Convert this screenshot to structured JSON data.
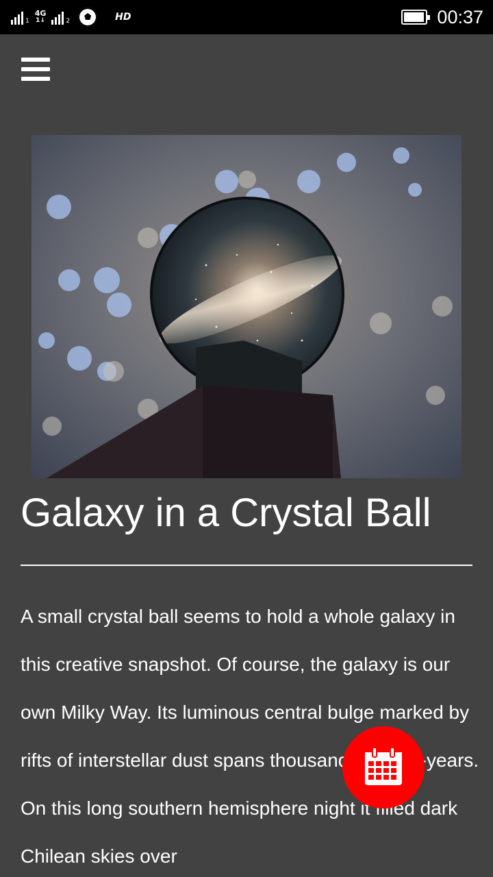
{
  "status_bar": {
    "sim1_label": "1",
    "sim2_label": "2",
    "network_type": "4G",
    "network_arrows": "1↓",
    "hd_label": "HD",
    "time": "00:37",
    "battery_level": 0.95
  },
  "app": {
    "menu_icon": "hamburger-menu-icon",
    "fab_icon": "calendar-icon",
    "fab_color": "#ff0000",
    "background_color": "#424242"
  },
  "article": {
    "image_alt": "crystal ball holding the Milky Way",
    "title": "Galaxy in a Crystal Ball",
    "body": "A small crystal ball seems to hold a whole galaxy in this creative snapshot. Of course, the galaxy is our own Milky Way. Its luminous central bulge marked by rifts of interstellar dust spans thousands of light-years. On this long southern hemisphere night it filled dark Chilean skies over"
  }
}
